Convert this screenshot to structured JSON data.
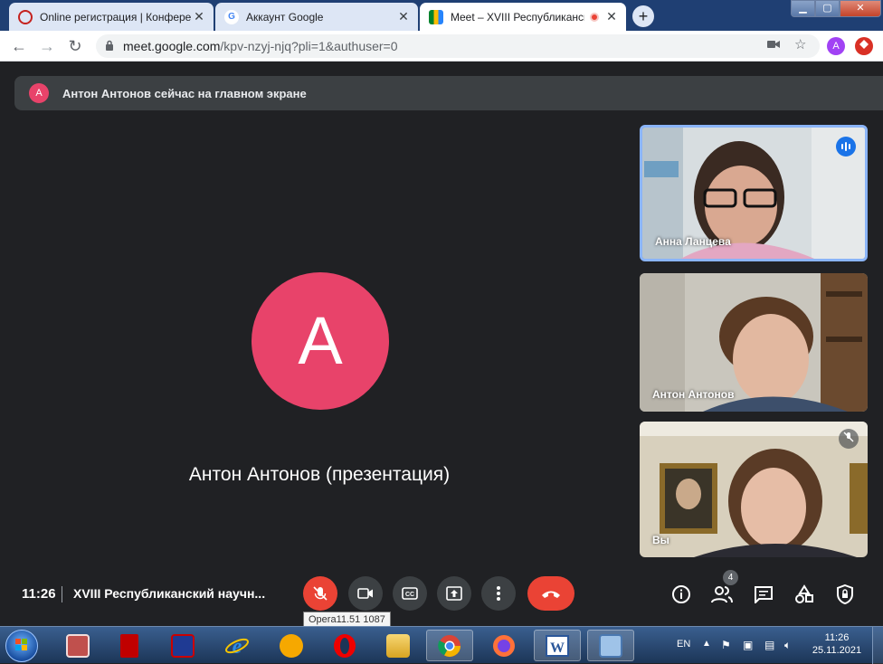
{
  "browser": {
    "tabs": [
      {
        "title": "Online регистрация | Конферен",
        "active": false
      },
      {
        "title": "Аккаунт Google",
        "active": false
      },
      {
        "title": "Meet – XVIII Республиканск",
        "active": true
      }
    ],
    "new_tab_glyph": "+",
    "close_glyph": "✕",
    "window_controls": {
      "minimize": "▁",
      "maximize": "▢",
      "close": "✕"
    },
    "address": {
      "host": "meet.google.com",
      "path": "/kpv-nzyj-njq?pli=1&authuser=0"
    },
    "profile_initial": "A",
    "nav_glyphs": {
      "back": "←",
      "forward": "→",
      "reload": "↻"
    }
  },
  "meet": {
    "banner": {
      "avatar_initial": "A",
      "text": "Антон Антонов сейчас на главном экране"
    },
    "main": {
      "avatar_initial": "A",
      "name": "Антон Антонов (презентация)",
      "avatar_color": "#e8436a"
    },
    "participants": [
      {
        "name": "Анна Ланцева",
        "speaking": true
      },
      {
        "name": "Антон Антонов",
        "speaking": false
      },
      {
        "name": "Вы",
        "muted": true
      }
    ],
    "controls": {
      "time": "11:26",
      "meeting_title": "XVIII Республиканский научн...",
      "participant_count": "4",
      "mic_tooltip": "Opera11.51 1087"
    },
    "colors": {
      "accent": "#1a73e8",
      "danger": "#ea4335",
      "background": "#202124"
    }
  },
  "taskbar": {
    "apps": [
      "presentation-app",
      "book-app",
      "disk-app",
      "internet-explorer",
      "aimp",
      "opera",
      "file-explorer",
      "chrome",
      "firefox",
      "word",
      "control-panel"
    ],
    "language": "EN",
    "time": "11:26",
    "date": "25.11.2021"
  }
}
